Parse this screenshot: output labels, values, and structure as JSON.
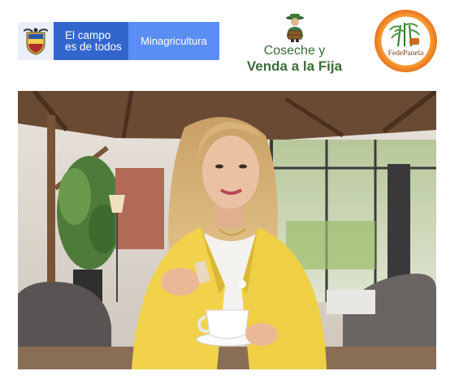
{
  "header": {
    "gov_logo": {
      "line1": "El campo",
      "line2": "es de todos",
      "ministry": "Minagricultura",
      "colors": {
        "primary": "#3366cc",
        "secondary": "#5b8ef5",
        "shield_bg": "#e9eef8"
      }
    },
    "campaign_logo": {
      "line1": "Coseche y",
      "line2": "Venda a la Fija",
      "color": "#3e6b3a",
      "icon": "farmer-icon"
    },
    "fedepanela_logo": {
      "label": "FedePanela",
      "ring_color": "#f0891e",
      "icon": "sugarcane-icon"
    }
  },
  "main": {
    "photo": {
      "icon": "woman-with-coffee-cup-photo"
    }
  }
}
